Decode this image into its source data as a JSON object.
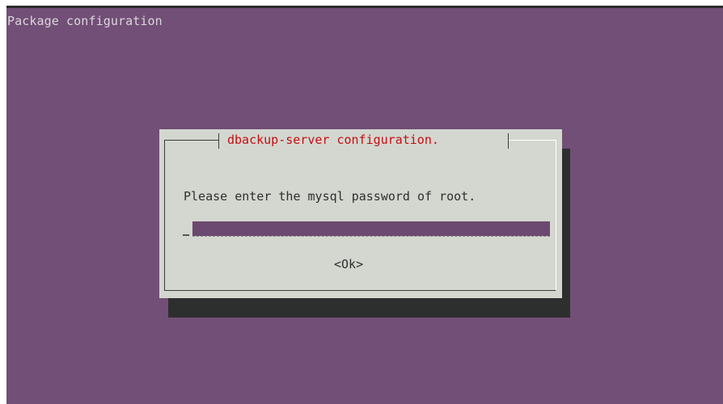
{
  "screen": {
    "title": "Package configuration",
    "background_color": "#724f76"
  },
  "dialog": {
    "title": "dbackup-server configuration.",
    "title_color": "#c30e14",
    "prompt": "Please enter the mysql password of root.",
    "password_value": "",
    "ok_label": "<Ok>"
  }
}
